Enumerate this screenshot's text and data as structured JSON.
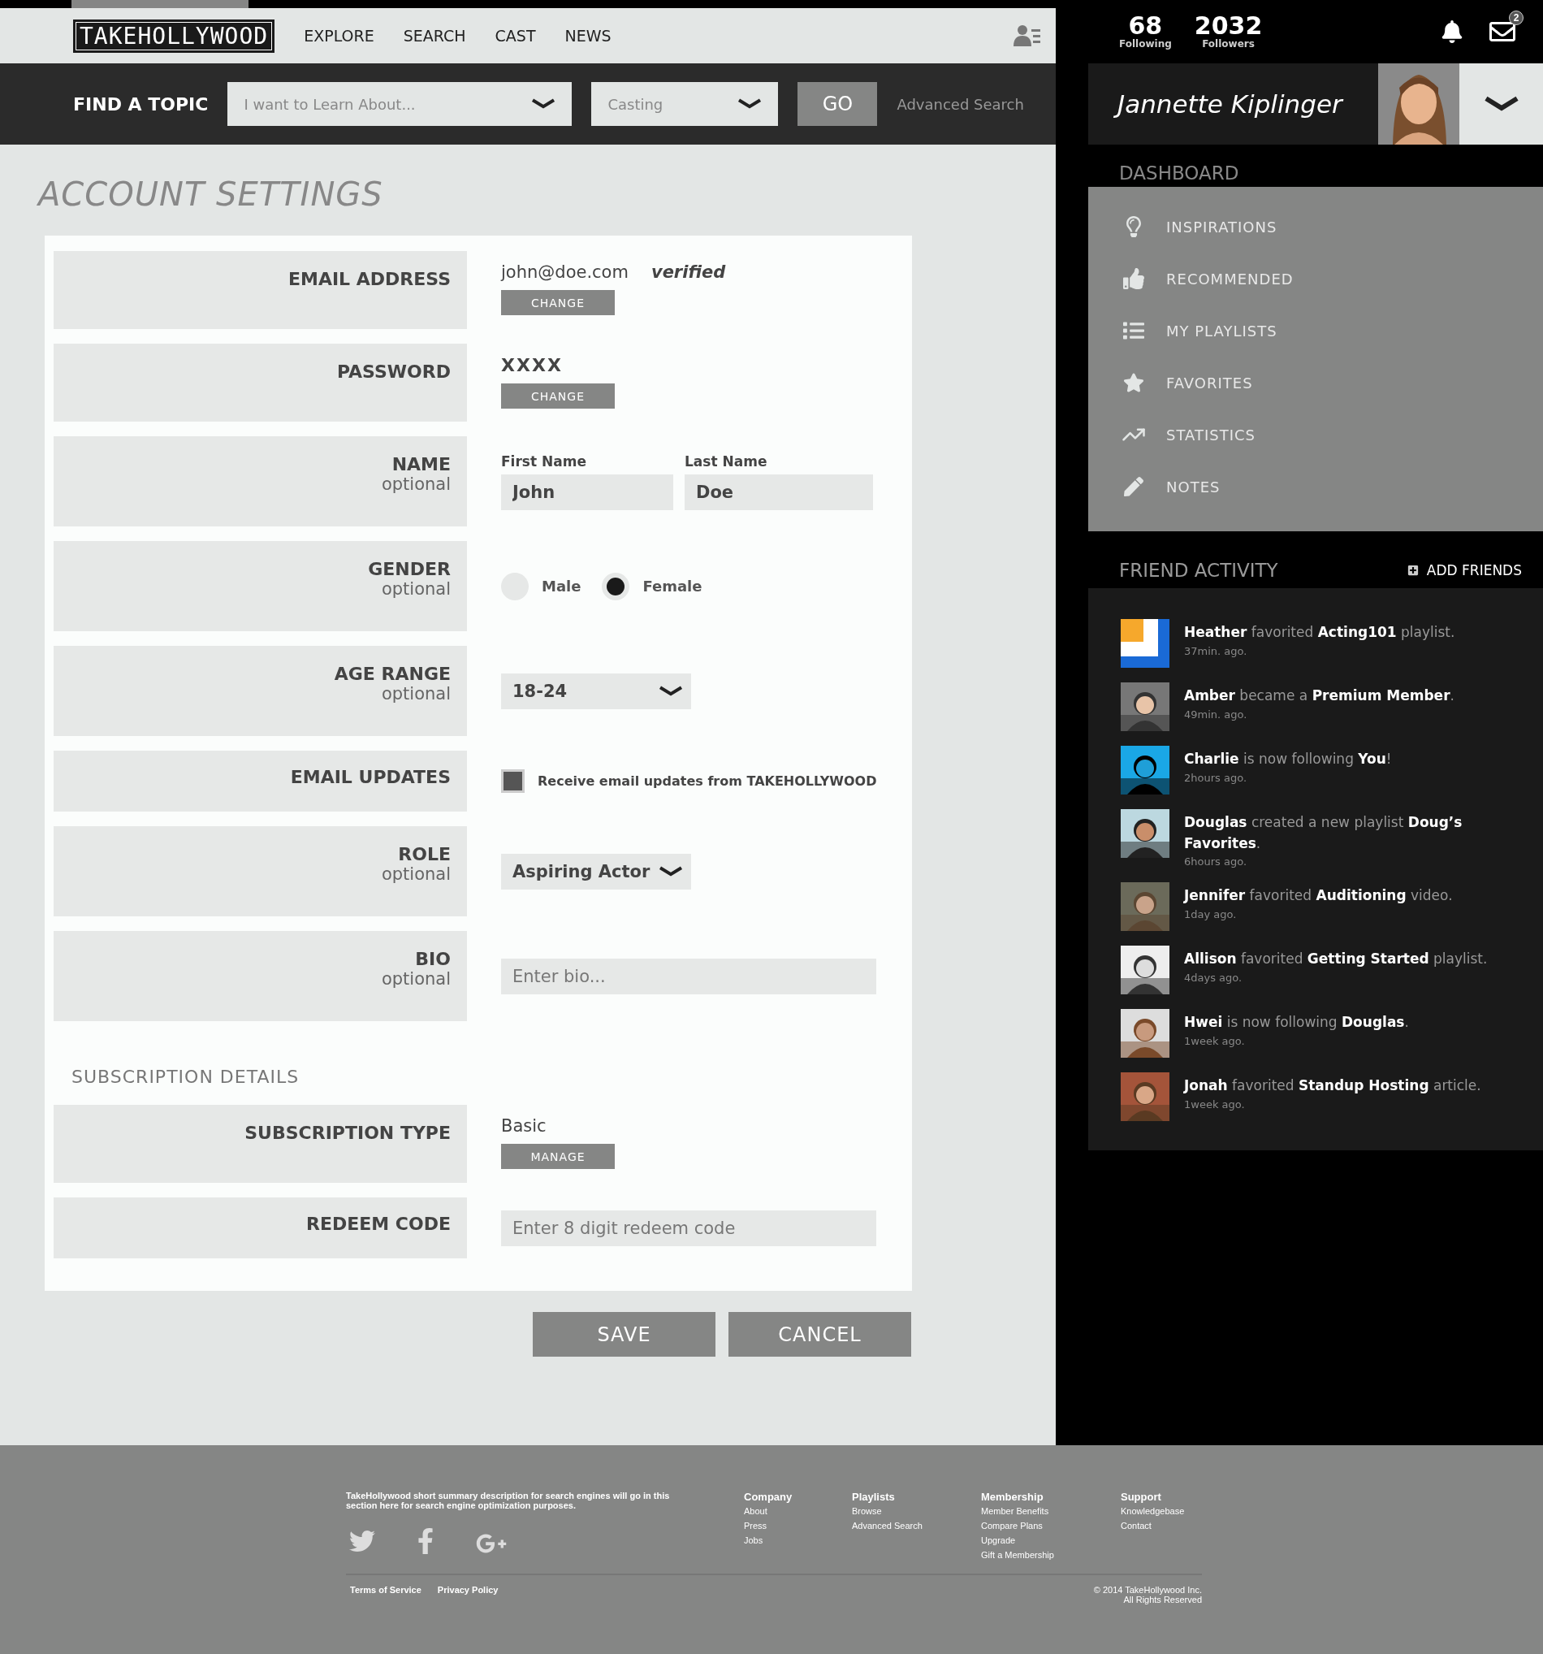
{
  "nav": {
    "logo": "TAKEHOLLYWOOD",
    "links": [
      "EXPLORE",
      "SEARCH",
      "CAST",
      "NEWS"
    ]
  },
  "search": {
    "title": "FIND A TOPIC",
    "topic_placeholder": "I want to Learn About...",
    "category": "Casting",
    "go": "GO",
    "advanced": "Advanced Search"
  },
  "page_title": "ACCOUNT SETTINGS",
  "fields": [
    {
      "kind": "value_action",
      "label": "EMAIL ADDRESS",
      "value": "john@doe.com",
      "note": "verified",
      "button": "CHANGE"
    },
    {
      "kind": "value_action",
      "label": "PASSWORD",
      "value": "XXXX",
      "button": "CHANGE",
      "masked": true
    },
    {
      "kind": "name_inputs",
      "label": "NAME",
      "hint": "optional",
      "inputs": [
        {
          "label": "First Name",
          "value": "John"
        },
        {
          "label": "Last Name",
          "value": "Doe"
        }
      ]
    },
    {
      "kind": "radio",
      "label": "GENDER",
      "hint": "optional",
      "options": [
        {
          "label": "Male",
          "selected": false
        },
        {
          "label": "Female",
          "selected": true
        }
      ]
    },
    {
      "kind": "select",
      "label": "AGE RANGE",
      "hint": "optional",
      "value": "18-24"
    },
    {
      "kind": "checkbox",
      "label": "EMAIL UPDATES",
      "text": "Receive email updates from TAKEHOLLYWOOD",
      "checked": true
    },
    {
      "kind": "select",
      "label": "ROLE",
      "hint": "optional",
      "value": "Aspiring Actor"
    },
    {
      "kind": "text_input",
      "label": "BIO",
      "hint": "optional",
      "placeholder": "Enter bio..."
    }
  ],
  "subscription": {
    "title": "SUBSCRIPTION DETAILS",
    "fields": [
      {
        "kind": "value_action",
        "label": "SUBSCRIPTION TYPE",
        "value": "Basic",
        "button": "MANAGE"
      },
      {
        "kind": "text_input",
        "label": "REDEEM CODE",
        "placeholder": "Enter 8 digit redeem code"
      }
    ]
  },
  "actions": [
    "SAVE",
    "CANCEL"
  ],
  "stats": [
    {
      "value": "68",
      "label": "Following"
    },
    {
      "value": "2032",
      "label": "Followers"
    }
  ],
  "messages_badge": "2",
  "profile": {
    "name": "Jannette Kiplinger"
  },
  "dashboard": {
    "title": "DASHBOARD",
    "items": [
      "INSPIRATIONS",
      "RECOMMENDED",
      "MY PLAYLISTS",
      "FAVORITES",
      "STATISTICS",
      "NOTES"
    ]
  },
  "friend_activity": {
    "title": "FRIEND ACTIVITY",
    "add_button": "ADD FRIENDS",
    "items": [
      {
        "text": "**Heather** favorited **Acting101** playlist.",
        "time": "37min. ago."
      },
      {
        "text": "**Amber** became a **Premium Member**.",
        "time": "49min. ago."
      },
      {
        "text": "**Charlie** is now following **You**!",
        "time": "2hours ago."
      },
      {
        "text": "**Douglas** created a new playlist **Doug’s Favorites**.",
        "time": "6hours ago."
      },
      {
        "text": "**Jennifer** favorited **Auditioning** video.",
        "time": "1day ago."
      },
      {
        "text": "**Allison** favorited **Getting Started** playlist.",
        "time": "4days ago."
      },
      {
        "text": "**Hwei** is now following **Douglas**.",
        "time": "1week ago."
      },
      {
        "text": "**Jonah** favorited **Standup Hosting** article.",
        "time": "1week ago."
      }
    ]
  },
  "footer": {
    "description": "TakeHollywood short summary description for  search engines will go in this section here for search engine optimization purposes.",
    "columns": [
      {
        "title": "Company",
        "links": [
          "About",
          "Press",
          "Jobs"
        ]
      },
      {
        "title": "Playlists",
        "links": [
          "Browse",
          "Advanced Search"
        ]
      },
      {
        "title": "Membership",
        "links": [
          "Member Benefits",
          "Compare Plans",
          "Upgrade",
          "Gift a Membership"
        ]
      },
      {
        "title": "Support",
        "links": [
          "Knowledgebase",
          "Contact"
        ]
      }
    ],
    "legal_links": [
      "Terms of Service",
      "Privacy Policy"
    ],
    "copyright": [
      "© 2014 TakeHollywood Inc.",
      "All Rights Reserved"
    ]
  }
}
